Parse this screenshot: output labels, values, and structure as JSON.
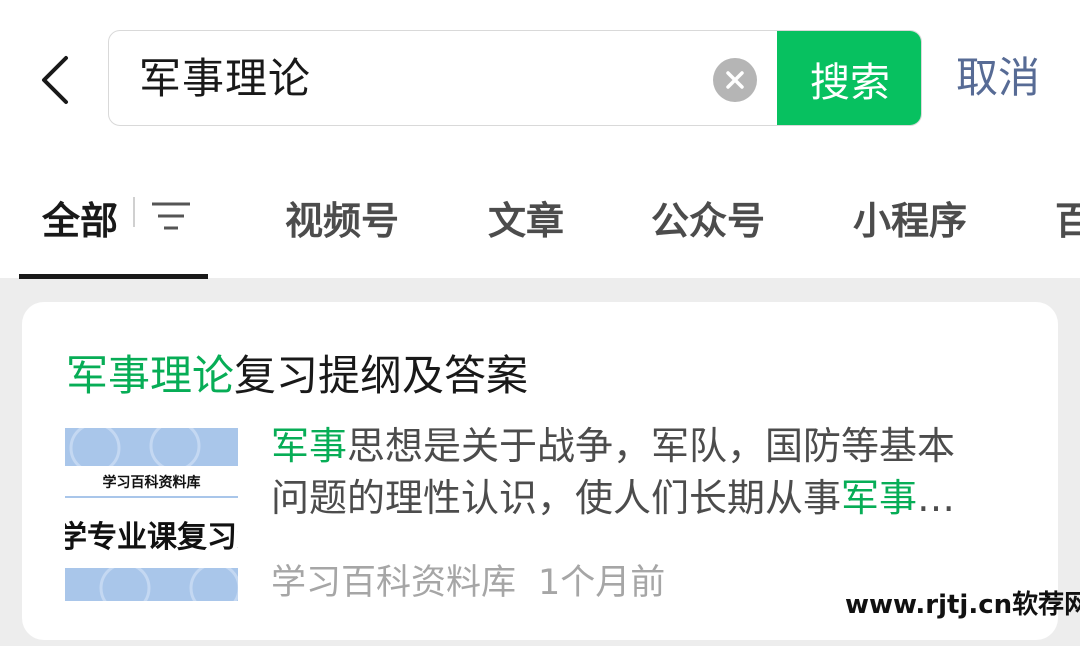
{
  "search": {
    "query": "军事理论",
    "button_label": "搜索",
    "cancel_label": "取消"
  },
  "tabs": [
    {
      "label": "全部"
    },
    {
      "label": "视频号"
    },
    {
      "label": "文章"
    },
    {
      "label": "公众号"
    },
    {
      "label": "小程序"
    },
    {
      "label": "百"
    }
  ],
  "result": {
    "title_highlight": "军事理论",
    "title_rest": "复习提纲及答案",
    "thumbnail": {
      "label": "学习百科资料库",
      "big_text": "学专业课复习资"
    },
    "snippet": {
      "line1_hl": "军事",
      "line1_rest": "思想是关于战争，军队，国防等基本",
      "line2_rest": "问题的理性认识，使人们长期从事",
      "line2_hl": "军事",
      "line2_tail": "…"
    },
    "source": "学习百科资料库",
    "time": "1个月前"
  },
  "watermark": "www.rjtj.cn软荐网",
  "colors": {
    "accent_green": "#07c160",
    "highlight_green": "#07ad56",
    "link_blue": "#576b95"
  },
  "icons": {
    "back": "chevron-left-icon",
    "clear": "clear-icon",
    "filter": "filter-icon"
  }
}
